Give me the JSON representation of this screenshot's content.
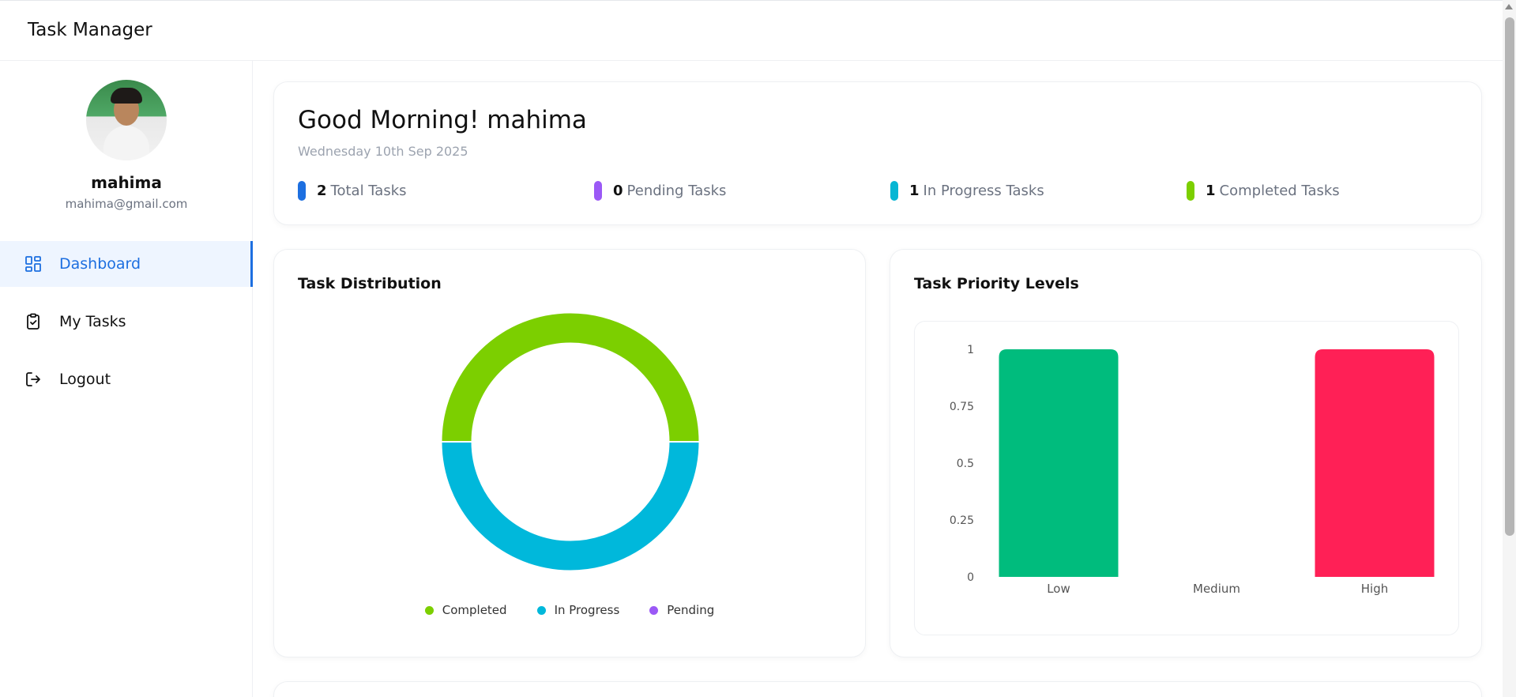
{
  "app": {
    "title": "Task Manager"
  },
  "user": {
    "name": "mahima",
    "email": "mahima@gmail.com"
  },
  "sidebar": {
    "items": [
      {
        "label": "Dashboard",
        "icon": "dashboard-icon",
        "active": true
      },
      {
        "label": "My Tasks",
        "icon": "clipboard-check-icon",
        "active": false
      },
      {
        "label": "Logout",
        "icon": "logout-icon",
        "active": false
      }
    ]
  },
  "header": {
    "greeting": "Good Morning! mahima",
    "date": "Wednesday 10th Sep 2025",
    "stats": [
      {
        "count": "2",
        "label": "Total Tasks",
        "color": "#1d6fe0"
      },
      {
        "count": "0",
        "label": "Pending Tasks",
        "color": "#9b59f6"
      },
      {
        "count": "1",
        "label": "In Progress Tasks",
        "color": "#06b6d4"
      },
      {
        "count": "1",
        "label": "Completed Tasks",
        "color": "#7ccf00"
      }
    ]
  },
  "distribution": {
    "title": "Task Distribution",
    "chart_data": {
      "type": "pie",
      "donut": true,
      "labels": [
        "Completed",
        "In Progress",
        "Pending"
      ],
      "values": [
        1,
        1,
        0
      ],
      "colors": [
        "#7ccf00",
        "#00b8db",
        "#9b59f6"
      ],
      "legend": "bottom"
    }
  },
  "priority": {
    "title": "Task Priority Levels",
    "chart_data": {
      "type": "bar",
      "categories": [
        "Low",
        "Medium",
        "High"
      ],
      "values": [
        1,
        0,
        1
      ],
      "colors": [
        "#00bc7d",
        "#f59e0b",
        "#ff2056"
      ],
      "ylim": [
        0,
        1
      ],
      "yticks": [
        "0",
        "0.25",
        "0.5",
        "0.75",
        "1"
      ],
      "grid": false
    }
  }
}
